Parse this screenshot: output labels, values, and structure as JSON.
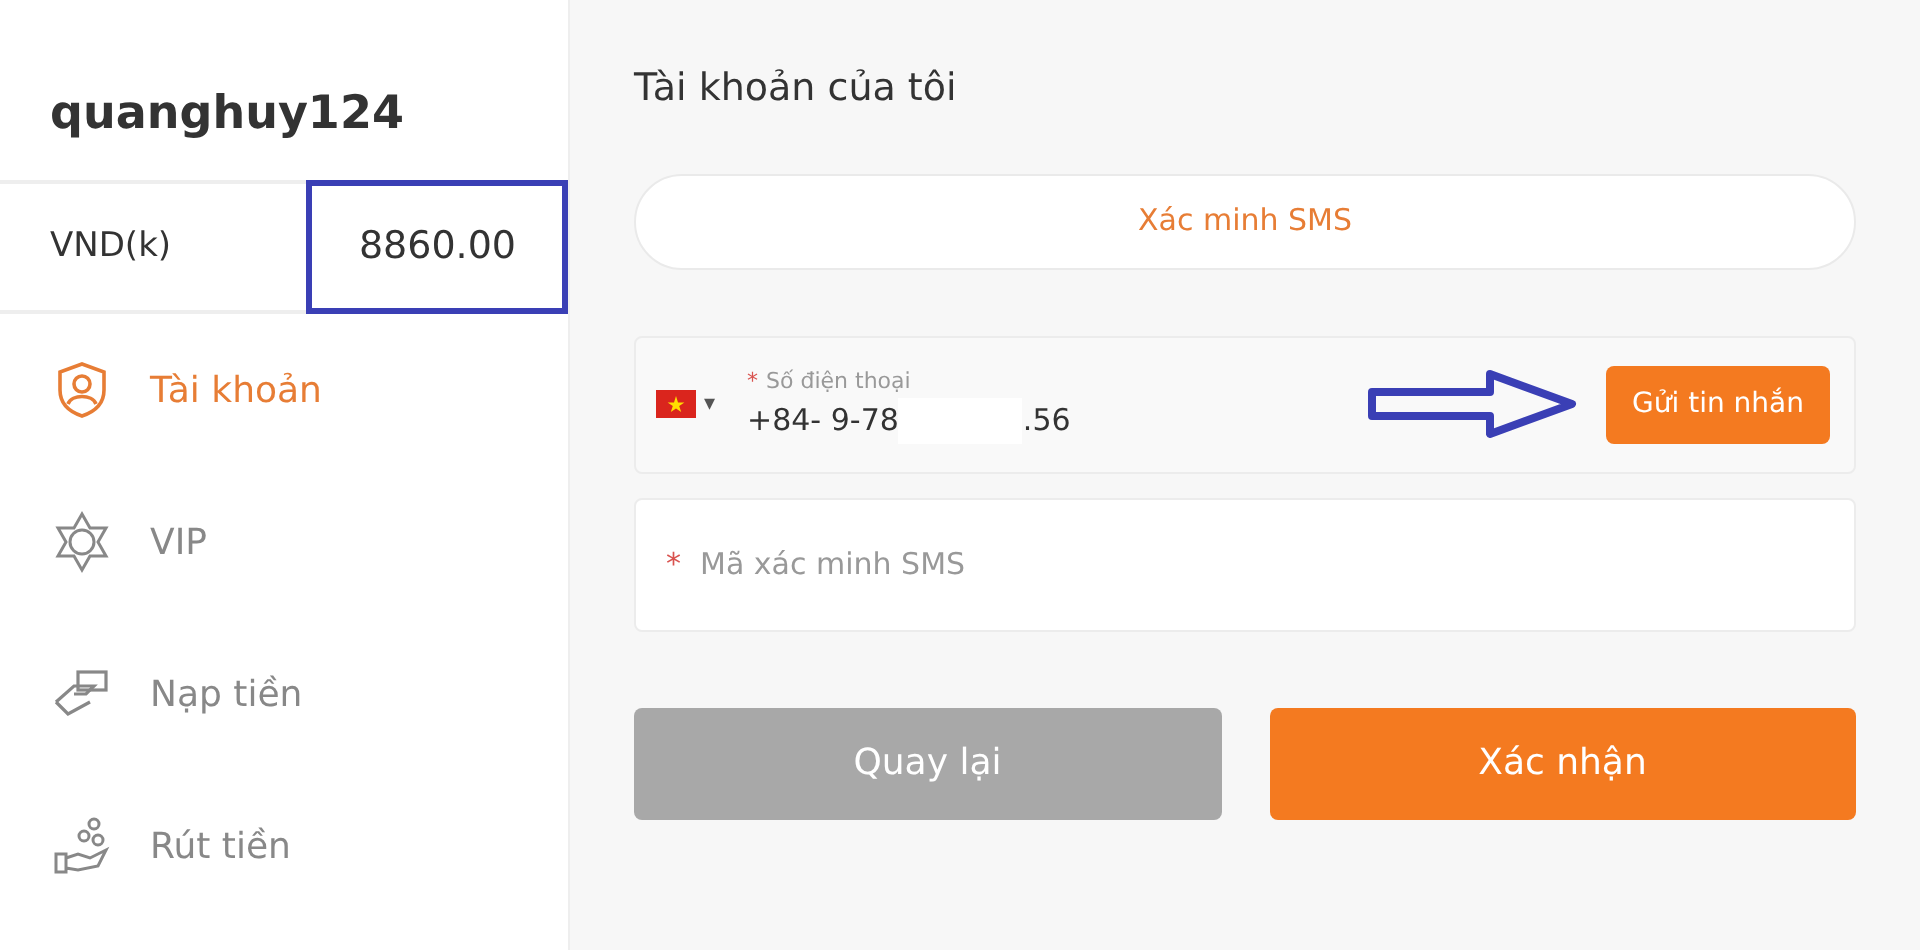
{
  "user": {
    "username": "quanghuy124",
    "currency": "VND(k)",
    "balance": "8860.00",
    "balance_highlighted": true
  },
  "menu": [
    {
      "label": "Tài khoản",
      "kind": "account",
      "selected": true
    },
    {
      "label": "VIP",
      "kind": "vip",
      "selected": false
    },
    {
      "label": "Nạp tiền",
      "kind": "deposit",
      "selected": false
    },
    {
      "label": "Rút tiền",
      "kind": "withdraw",
      "selected": false
    }
  ],
  "page_title": "Tài khoản của tôi",
  "sms_tab": "Xác minh SMS",
  "phone": {
    "required_mark": "*",
    "label": "Số điện thoại",
    "value_start": "+84- 9-78",
    "value_end": ".56",
    "country_caret": "▾",
    "send_button": "Gửi tin nhắn",
    "arrow_annotation": true
  },
  "code_field": {
    "required_mark": "*",
    "placeholder": "Mã xác minh SMS"
  },
  "buttons": [
    {
      "label": "Quay lại",
      "kind": "back"
    },
    {
      "label": "Xác nhận",
      "kind": "confirm"
    }
  ]
}
